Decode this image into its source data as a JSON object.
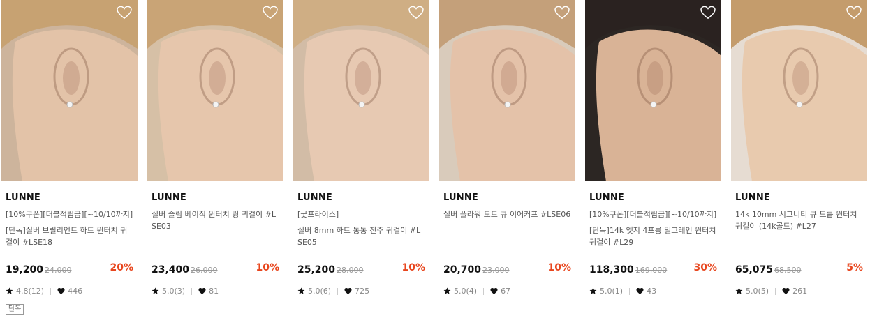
{
  "products": [
    {
      "brand": "LUNNE",
      "line1": "[10%쿠폰][더블적립금][~10/10까지]",
      "line2": "[단독]실버 브릴리언트 하트 원터치 귀걸이 #LSE18",
      "price": "19,200",
      "original_price": "24,000",
      "discount": "20%",
      "rating": "4.8(12)",
      "likes": "446",
      "tag": "단독",
      "wishlist_icon": "heart-outline-icon",
      "photo": "model-ear-cuff-photo"
    },
    {
      "brand": "LUNNE",
      "line1": "실버 슬림 베이직 원터치 링 귀걸이 #LSE03",
      "line2": "",
      "price": "23,400",
      "original_price": "26,000",
      "discount": "10%",
      "rating": "5.0(3)",
      "likes": "81",
      "tag": "",
      "wishlist_icon": "heart-outline-icon",
      "photo": "model-hoop-earring-photo"
    },
    {
      "brand": "LUNNE",
      "line1": "[굿프라이스]",
      "line2": "실버 8mm 하트 통통 진주 귀걸이 #LSE05",
      "price": "25,200",
      "original_price": "28,000",
      "discount": "10%",
      "rating": "5.0(6)",
      "likes": "725",
      "tag": "",
      "wishlist_icon": "heart-outline-icon",
      "photo": "model-heart-pearl-photo"
    },
    {
      "brand": "LUNNE",
      "line1": "실버 플라워 도트 큐 이어커프 #LSE06",
      "line2": "",
      "price": "20,700",
      "original_price": "23,000",
      "discount": "10%",
      "rating": "5.0(4)",
      "likes": "67",
      "tag": "",
      "wishlist_icon": "heart-outline-icon",
      "photo": "model-ear-cuff-hand-photo"
    },
    {
      "brand": "LUNNE",
      "line1": "[10%쿠폰][더블적립금][~10/10까지]",
      "line2": "[단독]14k 엣지 4프롱 밀그레인 원터치 귀걸이 #L29",
      "price": "118,300",
      "original_price": "169,000",
      "discount": "30%",
      "rating": "5.0(1)",
      "likes": "43",
      "tag": "",
      "wishlist_icon": "heart-outline-icon",
      "photo": "model-gold-earring-photo"
    },
    {
      "brand": "LUNNE",
      "line1": "14k 10mm 시그니티 큐 드롭 원터치 귀걸이 (14k골드) #L27",
      "line2": "",
      "price": "65,075",
      "original_price": "68,500",
      "discount": "5%",
      "rating": "5.0(5)",
      "likes": "261",
      "tag": "",
      "wishlist_icon": "heart-outline-icon",
      "photo": "model-drop-earring-photo"
    }
  ],
  "colors": {
    "discount": "#e8461e",
    "price": "#111111",
    "muted": "#888888"
  }
}
